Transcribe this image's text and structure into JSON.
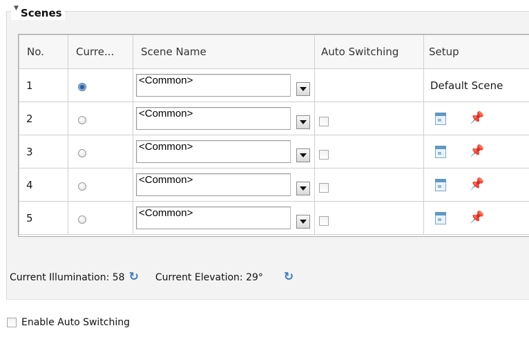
{
  "scenes": {
    "title": "Scenes",
    "columns": [
      "No.",
      "Curre...",
      "Scene Name",
      "Auto Switching",
      "Setup"
    ],
    "rows": [
      {
        "no": "1",
        "current": true,
        "scene": "<Common>",
        "auto_switching": null,
        "setup_text": "Default Scene"
      },
      {
        "no": "2",
        "current": false,
        "scene": "<Common>",
        "auto_switching": false,
        "setup_text": ""
      },
      {
        "no": "3",
        "current": false,
        "scene": "<Common>",
        "auto_switching": false,
        "setup_text": ""
      },
      {
        "no": "4",
        "current": false,
        "scene": "<Common>",
        "auto_switching": false,
        "setup_text": ""
      },
      {
        "no": "5",
        "current": false,
        "scene": "<Common>",
        "auto_switching": false,
        "setup_text": ""
      }
    ],
    "setup_icons": [
      "calendar-icon",
      "pin-icon"
    ]
  },
  "status": {
    "illumination_label": "Current Illumination: 58",
    "elevation_label": "Current Elevation: 29°"
  },
  "enable_auto_switching": {
    "label": "Enable Auto Switching",
    "checked": false
  },
  "colors": {
    "accent": "#3a7ac6",
    "pin": "#d6262b"
  }
}
